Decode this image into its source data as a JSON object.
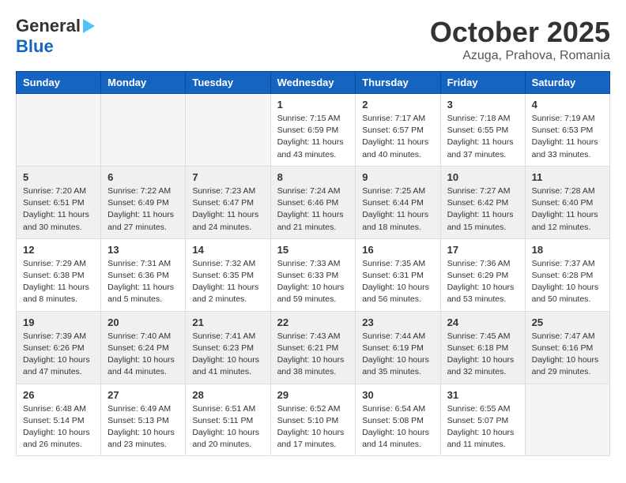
{
  "header": {
    "logo_general": "General",
    "logo_blue": "Blue",
    "month": "October 2025",
    "location": "Azuga, Prahova, Romania"
  },
  "weekdays": [
    "Sunday",
    "Monday",
    "Tuesday",
    "Wednesday",
    "Thursday",
    "Friday",
    "Saturday"
  ],
  "weeks": [
    [
      {
        "day": "",
        "info": ""
      },
      {
        "day": "",
        "info": ""
      },
      {
        "day": "",
        "info": ""
      },
      {
        "day": "1",
        "info": "Sunrise: 7:15 AM\nSunset: 6:59 PM\nDaylight: 11 hours\nand 43 minutes."
      },
      {
        "day": "2",
        "info": "Sunrise: 7:17 AM\nSunset: 6:57 PM\nDaylight: 11 hours\nand 40 minutes."
      },
      {
        "day": "3",
        "info": "Sunrise: 7:18 AM\nSunset: 6:55 PM\nDaylight: 11 hours\nand 37 minutes."
      },
      {
        "day": "4",
        "info": "Sunrise: 7:19 AM\nSunset: 6:53 PM\nDaylight: 11 hours\nand 33 minutes."
      }
    ],
    [
      {
        "day": "5",
        "info": "Sunrise: 7:20 AM\nSunset: 6:51 PM\nDaylight: 11 hours\nand 30 minutes."
      },
      {
        "day": "6",
        "info": "Sunrise: 7:22 AM\nSunset: 6:49 PM\nDaylight: 11 hours\nand 27 minutes."
      },
      {
        "day": "7",
        "info": "Sunrise: 7:23 AM\nSunset: 6:47 PM\nDaylight: 11 hours\nand 24 minutes."
      },
      {
        "day": "8",
        "info": "Sunrise: 7:24 AM\nSunset: 6:46 PM\nDaylight: 11 hours\nand 21 minutes."
      },
      {
        "day": "9",
        "info": "Sunrise: 7:25 AM\nSunset: 6:44 PM\nDaylight: 11 hours\nand 18 minutes."
      },
      {
        "day": "10",
        "info": "Sunrise: 7:27 AM\nSunset: 6:42 PM\nDaylight: 11 hours\nand 15 minutes."
      },
      {
        "day": "11",
        "info": "Sunrise: 7:28 AM\nSunset: 6:40 PM\nDaylight: 11 hours\nand 12 minutes."
      }
    ],
    [
      {
        "day": "12",
        "info": "Sunrise: 7:29 AM\nSunset: 6:38 PM\nDaylight: 11 hours\nand 8 minutes."
      },
      {
        "day": "13",
        "info": "Sunrise: 7:31 AM\nSunset: 6:36 PM\nDaylight: 11 hours\nand 5 minutes."
      },
      {
        "day": "14",
        "info": "Sunrise: 7:32 AM\nSunset: 6:35 PM\nDaylight: 11 hours\nand 2 minutes."
      },
      {
        "day": "15",
        "info": "Sunrise: 7:33 AM\nSunset: 6:33 PM\nDaylight: 10 hours\nand 59 minutes."
      },
      {
        "day": "16",
        "info": "Sunrise: 7:35 AM\nSunset: 6:31 PM\nDaylight: 10 hours\nand 56 minutes."
      },
      {
        "day": "17",
        "info": "Sunrise: 7:36 AM\nSunset: 6:29 PM\nDaylight: 10 hours\nand 53 minutes."
      },
      {
        "day": "18",
        "info": "Sunrise: 7:37 AM\nSunset: 6:28 PM\nDaylight: 10 hours\nand 50 minutes."
      }
    ],
    [
      {
        "day": "19",
        "info": "Sunrise: 7:39 AM\nSunset: 6:26 PM\nDaylight: 10 hours\nand 47 minutes."
      },
      {
        "day": "20",
        "info": "Sunrise: 7:40 AM\nSunset: 6:24 PM\nDaylight: 10 hours\nand 44 minutes."
      },
      {
        "day": "21",
        "info": "Sunrise: 7:41 AM\nSunset: 6:23 PM\nDaylight: 10 hours\nand 41 minutes."
      },
      {
        "day": "22",
        "info": "Sunrise: 7:43 AM\nSunset: 6:21 PM\nDaylight: 10 hours\nand 38 minutes."
      },
      {
        "day": "23",
        "info": "Sunrise: 7:44 AM\nSunset: 6:19 PM\nDaylight: 10 hours\nand 35 minutes."
      },
      {
        "day": "24",
        "info": "Sunrise: 7:45 AM\nSunset: 6:18 PM\nDaylight: 10 hours\nand 32 minutes."
      },
      {
        "day": "25",
        "info": "Sunrise: 7:47 AM\nSunset: 6:16 PM\nDaylight: 10 hours\nand 29 minutes."
      }
    ],
    [
      {
        "day": "26",
        "info": "Sunrise: 6:48 AM\nSunset: 5:14 PM\nDaylight: 10 hours\nand 26 minutes."
      },
      {
        "day": "27",
        "info": "Sunrise: 6:49 AM\nSunset: 5:13 PM\nDaylight: 10 hours\nand 23 minutes."
      },
      {
        "day": "28",
        "info": "Sunrise: 6:51 AM\nSunset: 5:11 PM\nDaylight: 10 hours\nand 20 minutes."
      },
      {
        "day": "29",
        "info": "Sunrise: 6:52 AM\nSunset: 5:10 PM\nDaylight: 10 hours\nand 17 minutes."
      },
      {
        "day": "30",
        "info": "Sunrise: 6:54 AM\nSunset: 5:08 PM\nDaylight: 10 hours\nand 14 minutes."
      },
      {
        "day": "31",
        "info": "Sunrise: 6:55 AM\nSunset: 5:07 PM\nDaylight: 10 hours\nand 11 minutes."
      },
      {
        "day": "",
        "info": ""
      }
    ]
  ]
}
